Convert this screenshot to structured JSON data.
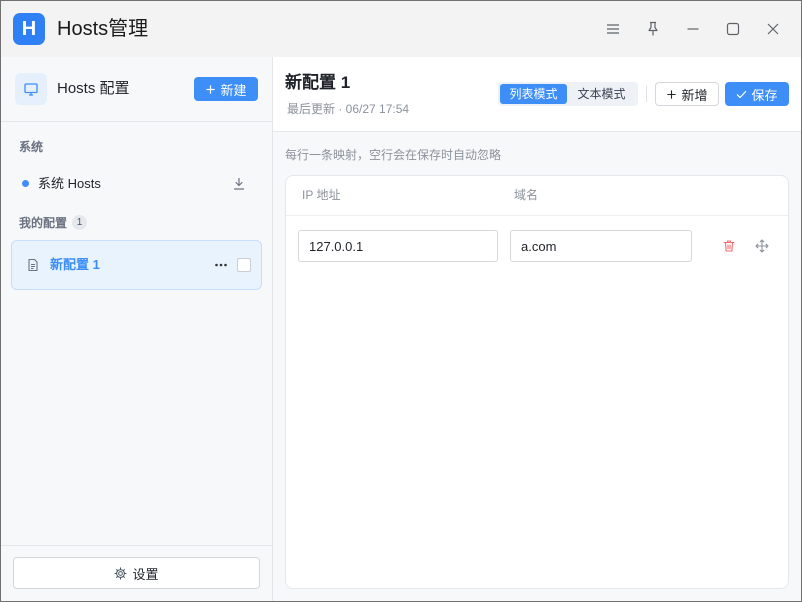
{
  "window": {
    "title": "Hosts管理",
    "app_icon_letter": "H",
    "controls": [
      "menu-icon",
      "pin-icon",
      "minimize-icon",
      "maximize-icon",
      "close-icon"
    ]
  },
  "sidebar": {
    "title": "Hosts 配置",
    "title_icon": "monitor-icon",
    "new_button": {
      "label": "新建",
      "icon": "plus-icon"
    },
    "system_section": {
      "label": "系统",
      "items": [
        {
          "label": "系统 Hosts",
          "status_dot_color": "#3d8ef6",
          "action_icon": "download-icon"
        }
      ]
    },
    "my_configs_section": {
      "label": "我的配置",
      "count": "1",
      "items": [
        {
          "label": "新配置 1",
          "icon": "document-icon",
          "selected": true,
          "checked": false,
          "more_icon": "more-icon"
        }
      ]
    },
    "settings_button": {
      "label": "设置",
      "icon": "gear-icon"
    }
  },
  "main": {
    "title": "新配置 1",
    "last_updated": "最后更新 · 06/27 17:54",
    "view_modes": [
      {
        "label": "列表模式",
        "active": true
      },
      {
        "label": "文本模式",
        "active": false
      }
    ],
    "add_button": {
      "label": "新增",
      "icon": "plus-icon"
    },
    "save_button": {
      "label": "保存",
      "icon": "check-icon"
    },
    "hint": "每行一条映射，空行会在保存时自动忽略",
    "table": {
      "columns": [
        "IP 地址",
        "域名"
      ],
      "rows": [
        {
          "ip": "127.0.0.1",
          "domain": "a.com",
          "actions": [
            "delete-icon",
            "drag-handle-icon"
          ]
        }
      ]
    }
  },
  "colors": {
    "primary": "#3d8ef6",
    "selected_bg": "#e9f3fe",
    "danger": "#f56c6c",
    "text": "#1f2329",
    "muted": "#8c929b"
  }
}
